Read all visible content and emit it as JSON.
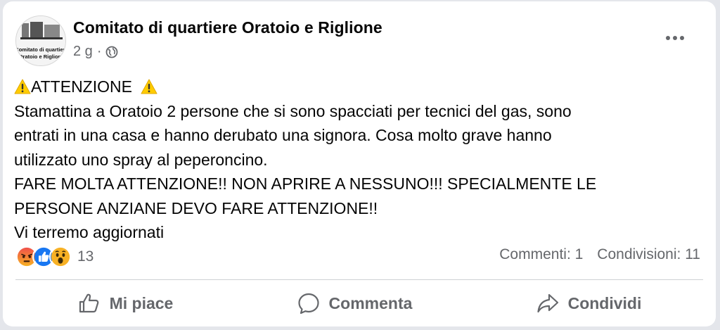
{
  "post": {
    "author": "Comitato di quartiere Oratoio e Riglione",
    "time": "2 g",
    "separator": "·",
    "privacy_icon": "globe-icon",
    "more_icon": "more-horizontal-icon",
    "avatar_text_line1": "Comitato di quartiere",
    "avatar_text_line2": "Oratoio e Riglione",
    "heading": "ATTENZIONE",
    "body_lines": [
      "Stamattina a Oratoio 2 persone che si sono spacciati per tecnici del gas, sono",
      "entrati in una casa e hanno derubato una signora. Cosa molto grave hanno",
      "utilizzato uno spray al peperoncino.",
      "FARE MOLTA ATTENZIONE!! NON APRIRE A NESSUNO!!! SPECIALMENTE LE",
      "PERSONE ANZIANE DEVO FARE ATTENZIONE!!",
      "Vi terremo aggiornati"
    ]
  },
  "reactions": {
    "icons": [
      "angry-reaction-icon",
      "like-reaction-icon",
      "wow-reaction-icon"
    ],
    "count": "13",
    "comments": "Commenti: 1",
    "shares": "Condivisioni: 11"
  },
  "actions": {
    "like": "Mi piace",
    "comment": "Commenta",
    "share": "Condividi"
  },
  "colors": {
    "secondary_text": "#65676b",
    "like_blue": "#1877f2",
    "angry_red": "#f0504a",
    "wow_yellow": "#f7b125",
    "warning_yellow": "#ffcc00"
  }
}
